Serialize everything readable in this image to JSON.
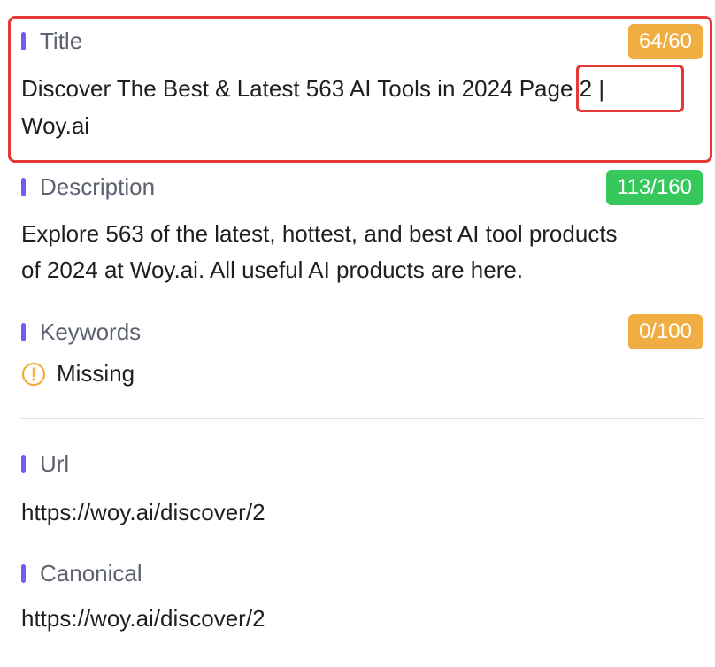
{
  "title": {
    "label": "Title",
    "count_badge": "64/60",
    "text_line1": "Discover The Best & Latest 563 AI Tools in 2024 Page 2 |",
    "text_line2": "Woy.ai"
  },
  "description": {
    "label": "Description",
    "count_badge": "113/160",
    "text_line1": "Explore 563 of the latest, hottest, and best AI tool products",
    "text_line2": "of 2024 at Woy.ai. All useful AI products are here."
  },
  "keywords": {
    "label": "Keywords",
    "count_badge": "0/100",
    "status_text": "Missing",
    "status_icon": "warning-circle-icon"
  },
  "url": {
    "label": "Url",
    "value": "https://woy.ai/discover/2"
  },
  "canonical": {
    "label": "Canonical",
    "value": "https://woy.ai/discover/2"
  },
  "colors": {
    "accent_bar": "#6d5ff0",
    "badge_orange": "#f0ae42",
    "badge_green": "#37c85c",
    "highlight_red": "#e53935"
  }
}
